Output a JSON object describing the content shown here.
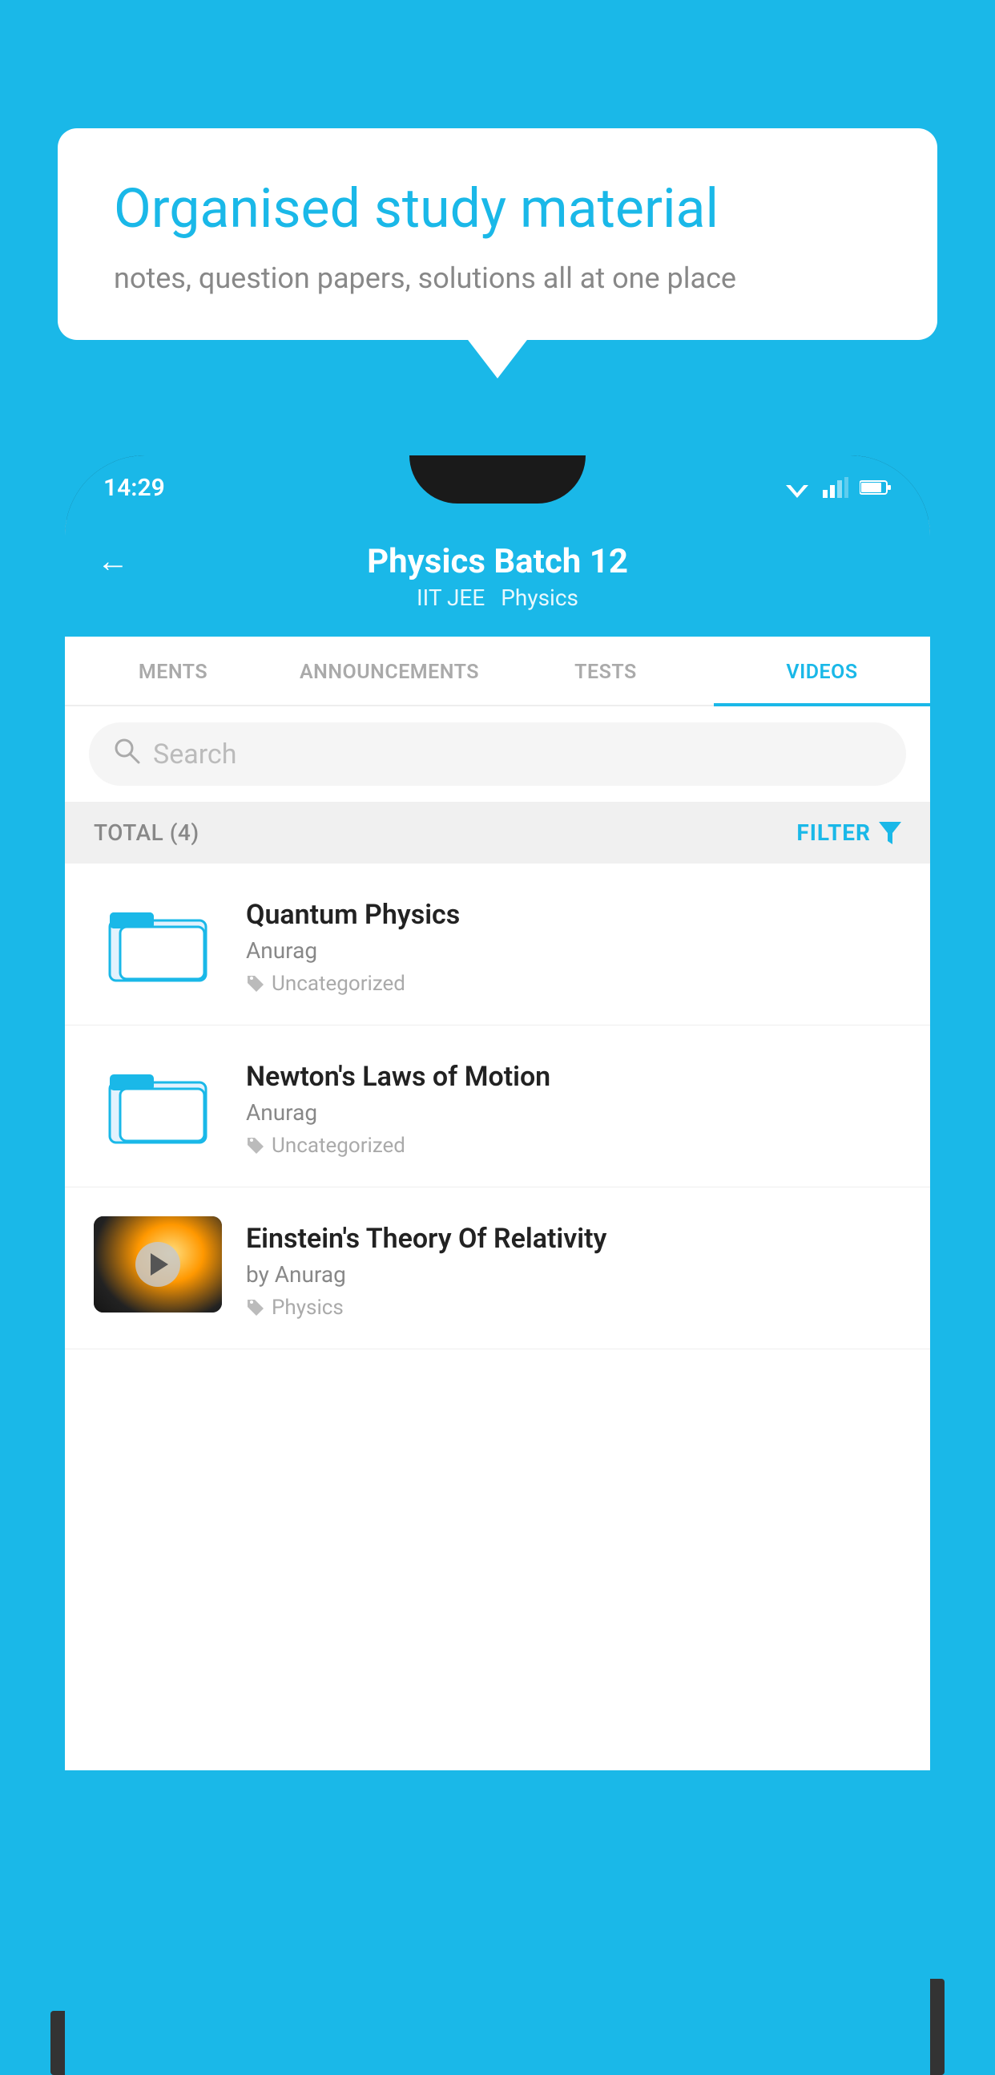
{
  "background_color": "#1ab8e8",
  "speech_bubble": {
    "title": "Organised study material",
    "subtitle": "notes, question papers, solutions all at one place"
  },
  "status_bar": {
    "time": "14:29"
  },
  "app_header": {
    "title": "Physics Batch 12",
    "tags": [
      "IIT JEE",
      "Physics"
    ],
    "back_label": "←"
  },
  "tabs": [
    {
      "label": "MENTS",
      "active": false
    },
    {
      "label": "ANNOUNCEMENTS",
      "active": false
    },
    {
      "label": "TESTS",
      "active": false
    },
    {
      "label": "VIDEOS",
      "active": true
    }
  ],
  "search": {
    "placeholder": "Search"
  },
  "filter_bar": {
    "total_label": "TOTAL (4)",
    "filter_label": "FILTER"
  },
  "video_items": [
    {
      "id": 1,
      "title": "Quantum Physics",
      "author": "Anurag",
      "tag": "Uncategorized",
      "type": "folder"
    },
    {
      "id": 2,
      "title": "Newton's Laws of Motion",
      "author": "Anurag",
      "tag": "Uncategorized",
      "type": "folder"
    },
    {
      "id": 3,
      "title": "Einstein's Theory Of Relativity",
      "author": "by Anurag",
      "tag": "Physics",
      "type": "video"
    }
  ]
}
